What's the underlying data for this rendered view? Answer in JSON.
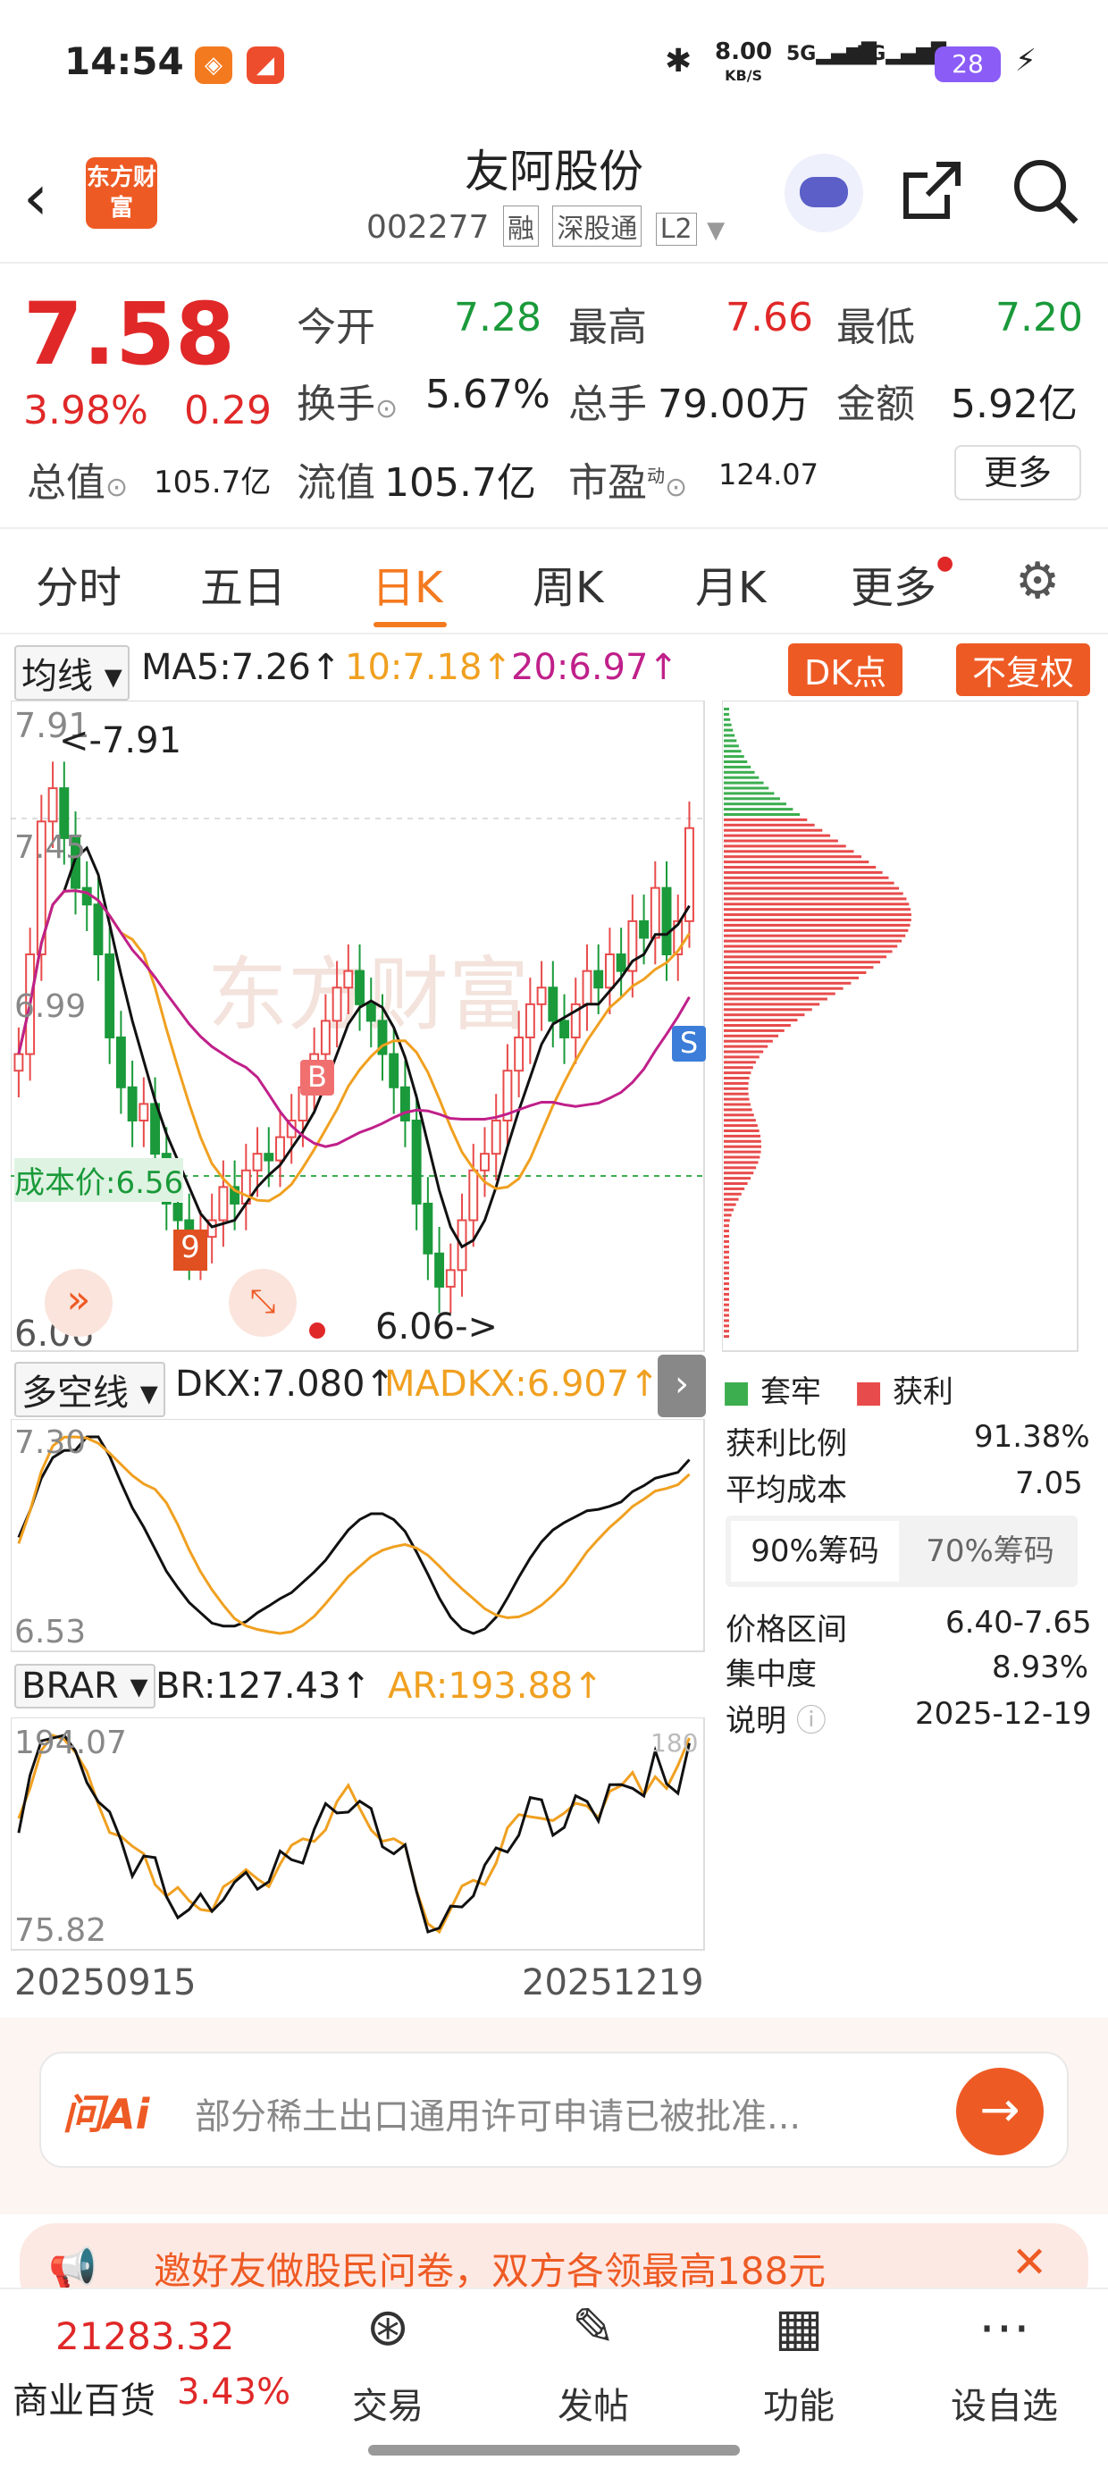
{
  "status": {
    "time": "14:54",
    "speed": "8.00",
    "speed_unit": "KB/S",
    "net1": "5G",
    "net2": "5G",
    "battery": "28"
  },
  "header": {
    "logo": "东方财富",
    "title": "友阿股份",
    "code": "002277",
    "tags": [
      "融",
      "深股通",
      "L2"
    ]
  },
  "quote": {
    "price": "7.58",
    "pct": "3.98%",
    "chg": "0.29",
    "fields": [
      {
        "label": "今开",
        "value": "7.28",
        "color": "green"
      },
      {
        "label": "最高",
        "value": "7.66",
        "color": "red"
      },
      {
        "label": "最低",
        "value": "7.20",
        "color": "green"
      },
      {
        "label": "换手",
        "value": "5.67%"
      },
      {
        "label": "总手",
        "value": "79.00万"
      },
      {
        "label": "金额",
        "value": "5.92亿"
      },
      {
        "label": "总值",
        "value": "105.7亿"
      },
      {
        "label": "流值",
        "value": "105.7亿"
      },
      {
        "label": "市盈",
        "value": "124.07"
      }
    ],
    "more": "更多"
  },
  "tabs": [
    "分时",
    "五日",
    "日K",
    "周K",
    "月K",
    "更多"
  ],
  "ma": {
    "selector": "均线",
    "ma5": "MA5:7.26↑",
    "ma10": "10:7.18↑",
    "ma20": "20:6.97↑",
    "dk": "DK点",
    "fq": "不复权"
  },
  "kchart": {
    "top": "7.91",
    "high_label": "<-7.91",
    "low": "6.06",
    "low_label": "6.06->",
    "mid1": "7.45",
    "mid2": "6.99",
    "cost": "成本价:6.56",
    "watermark": "东方财富"
  },
  "dkx": {
    "selector": "多空线",
    "dkx": "DKX:7.080↑",
    "madkx": "MADKX:6.907↑",
    "top": "7.30",
    "bot": "6.53"
  },
  "brar": {
    "selector": "BRAR",
    "br": "BR:127.43↑",
    "ar": "AR:193.88↑",
    "top": "194.07",
    "bot": "75.82",
    "r": "180"
  },
  "dates": {
    "start": "20250915",
    "end": "20251219"
  },
  "chips": {
    "legend_trap": "套牢",
    "legend_profit": "获利",
    "rows": [
      {
        "label": "获利比例",
        "value": "91.38%"
      },
      {
        "label": "平均成本",
        "value": "7.05"
      }
    ],
    "tab1": "90%筹码",
    "tab2": "70%筹码",
    "rows2": [
      {
        "label": "价格区间",
        "value": "6.40-7.65"
      },
      {
        "label": "集中度",
        "value": "8.93%"
      },
      {
        "label": "说明",
        "value": "2025-12-19"
      }
    ]
  },
  "ask": {
    "logo": "问Ai",
    "text": "部分稀土出口通用许可申请已被批准..."
  },
  "banner": "邀好友做股民问卷，双方各领最高188元",
  "index": {
    "value": "21283.32",
    "name": "商业百货",
    "pct": "3.43%"
  },
  "nav": [
    "交易",
    "发帖",
    "功能",
    "设自选"
  ],
  "chart_data": {
    "type": "candlestick",
    "x_range": [
      "20250915",
      "20251219"
    ],
    "ylim": [
      6.06,
      7.91
    ],
    "last_close": 7.58,
    "closes": [
      6.9,
      7.2,
      7.6,
      7.7,
      7.55,
      7.4,
      7.35,
      7.2,
      6.95,
      6.8,
      6.7,
      6.75,
      6.6,
      6.45,
      6.4,
      6.3,
      6.35,
      6.4,
      6.5,
      6.45,
      6.55,
      6.6,
      6.58,
      6.65,
      6.7,
      6.8,
      6.9,
      7.0,
      7.1,
      7.15,
      7.05,
      7.0,
      6.9,
      6.8,
      6.7,
      6.45,
      6.3,
      6.2,
      6.25,
      6.4,
      6.55,
      6.6,
      6.7,
      6.85,
      6.95,
      7.05,
      7.1,
      7.0,
      6.95,
      7.05,
      7.15,
      7.1,
      7.2,
      7.15,
      7.3,
      7.25,
      7.4,
      7.2,
      7.3,
      7.58
    ],
    "ma5_last": 7.26,
    "ma10_last": 7.18,
    "ma20_last": 6.97
  }
}
